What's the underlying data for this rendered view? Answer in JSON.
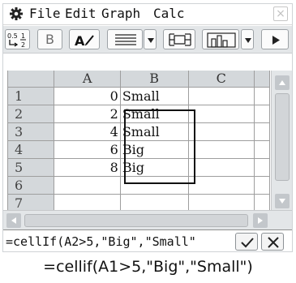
{
  "menu": {
    "settings_icon": "gear-icon",
    "items": [
      "File",
      "Edit",
      "Graph",
      "Calc"
    ],
    "close_icon": "close-icon",
    "close_glyph": "×"
  },
  "toolbar": {
    "buttons": [
      {
        "name": "fraction-decimal-toggle",
        "icon": "fraction-decimal-icon",
        "label": "0.5 1/2"
      },
      {
        "name": "bold-button",
        "label": "B"
      },
      {
        "name": "bold-text-button",
        "icon": "bold-pen-icon",
        "label": "A"
      },
      {
        "name": "alignment-button",
        "icon": "align-lines-icon"
      },
      {
        "name": "cell-button",
        "icon": "cell-reference-icon"
      },
      {
        "name": "chart-button",
        "icon": "bar-chart-icon"
      },
      {
        "name": "next-button",
        "icon": "play-icon"
      }
    ]
  },
  "sheet": {
    "columns": [
      "A",
      "B",
      "C"
    ],
    "rows": [
      {
        "row": "1",
        "A": "0",
        "B": "Small",
        "C": ""
      },
      {
        "row": "2",
        "A": "2",
        "B": "Small",
        "C": ""
      },
      {
        "row": "3",
        "A": "4",
        "B": "Small",
        "C": ""
      },
      {
        "row": "4",
        "A": "6",
        "B": "Big",
        "C": ""
      },
      {
        "row": "5",
        "A": "8",
        "B": "Big",
        "C": ""
      },
      {
        "row": "6",
        "A": "",
        "B": "",
        "C": ""
      },
      {
        "row": "7",
        "A": "",
        "B": "",
        "C": ""
      }
    ],
    "selection": "B2:B5"
  },
  "editline": {
    "value": "=cellIf(A2>5,\"Big\",\"Small\"",
    "ok_icon": "check-icon",
    "cancel_icon": "close-icon",
    "ok_glyph": "✓",
    "cancel_glyph": "✕"
  },
  "caption": "=cellif(A1>5,\"Big\",\"Small\")",
  "colors": {
    "toolbar_bg": "#e3e6e8",
    "header_bg": "#d4d8db",
    "border": "#9e9e9e"
  }
}
